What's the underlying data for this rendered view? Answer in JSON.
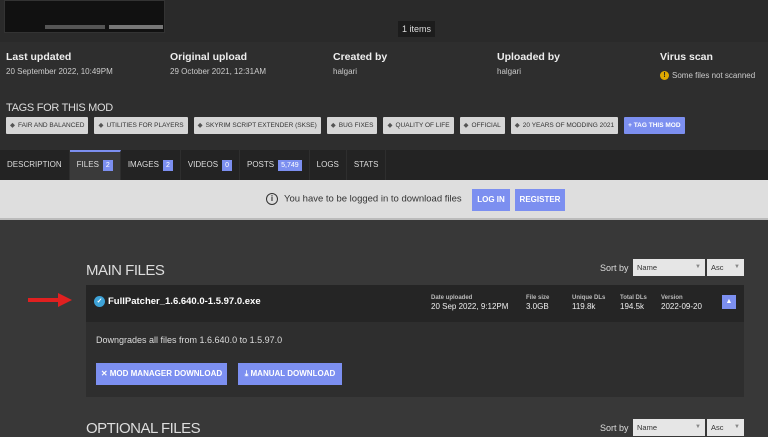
{
  "gallery": {
    "count_label": "1 items"
  },
  "info": [
    {
      "heading": "Last updated",
      "value": "20 September 2022, 10:49PM"
    },
    {
      "heading": "Original upload",
      "value": "29 October 2021, 12:31AM"
    },
    {
      "heading": "Created by",
      "value": "halgari"
    },
    {
      "heading": "Uploaded by",
      "value": "halgari"
    },
    {
      "heading": "Virus scan",
      "value": "Some files not scanned"
    }
  ],
  "tags": {
    "title": "TAGS FOR THIS MOD",
    "items": [
      "FAIR AND BALANCED",
      "UTILITIES FOR PLAYERS",
      "SKYRIM SCRIPT EXTENDER (SKSE)",
      "BUG FIXES",
      "QUALITY OF LIFE",
      "OFFICIAL",
      "20 YEARS OF MODDING 2021"
    ],
    "add_label": "TAG THIS MOD"
  },
  "tabs": [
    {
      "label": "DESCRIPTION"
    },
    {
      "label": "FILES",
      "badge": "2"
    },
    {
      "label": "IMAGES",
      "badge": "2"
    },
    {
      "label": "VIDEOS",
      "badge": "0"
    },
    {
      "label": "POSTS",
      "badge": "5,749"
    },
    {
      "label": "LOGS"
    },
    {
      "label": "STATS"
    }
  ],
  "login": {
    "message": "You have to be logged in to download files",
    "login": "LOG IN",
    "register": "REGISTER"
  },
  "main_files": {
    "title": "MAIN FILES",
    "sort_label": "Sort by",
    "sort_value": "Name",
    "order_value": "Asc",
    "file": {
      "name": "FullPatcher_1.6.640.0-1.5.97.0.exe",
      "stats": [
        {
          "label": "Date uploaded",
          "value": "20 Sep 2022, 9:12PM"
        },
        {
          "label": "File size",
          "value": "3.0GB"
        },
        {
          "label": "Unique DLs",
          "value": "119.8k"
        },
        {
          "label": "Total DLs",
          "value": "194.5k"
        },
        {
          "label": "Version",
          "value": "2022-09-20"
        }
      ],
      "description": "Downgrades all files from 1.6.640.0 to 1.5.97.0",
      "mod_manager_download": "MOD MANAGER DOWNLOAD",
      "manual_download": "MANUAL DOWNLOAD"
    }
  },
  "optional_files": {
    "title": "OPTIONAL FILES",
    "sort_label": "Sort by",
    "sort_value": "Name",
    "order_value": "Asc"
  },
  "colors": {
    "accent": "#7c8ff0",
    "arrow": "#e02020",
    "warning": "#e0a800"
  }
}
